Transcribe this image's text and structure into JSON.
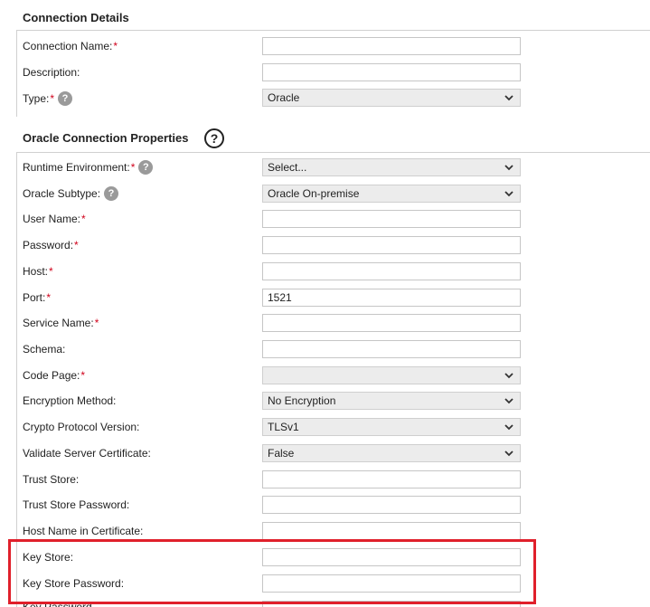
{
  "connection_details": {
    "title": "Connection Details",
    "fields": [
      {
        "label": "Connection Name:",
        "required": true,
        "value": ""
      },
      {
        "label": "Description:",
        "required": false,
        "value": ""
      },
      {
        "label": "Type:",
        "required": true,
        "value": "Oracle"
      }
    ]
  },
  "oracle_properties": {
    "title": "Oracle Connection Properties",
    "help_icon": "?",
    "fields": [
      {
        "label": "Runtime Environment:",
        "required": true,
        "value": "Select..."
      },
      {
        "label": "Oracle Subtype:",
        "required": false,
        "value": "Oracle On-premise"
      },
      {
        "label": "User Name:",
        "required": true,
        "value": ""
      },
      {
        "label": "Password:",
        "required": true,
        "value": ""
      },
      {
        "label": "Host:",
        "required": true,
        "value": ""
      },
      {
        "label": "Port:",
        "required": true,
        "value": "1521"
      },
      {
        "label": "Service Name:",
        "required": true,
        "value": ""
      },
      {
        "label": "Schema:",
        "required": false,
        "value": ""
      },
      {
        "label": "Code Page:",
        "required": true,
        "value": ""
      },
      {
        "label": "Encryption Method:",
        "required": false,
        "value": "No Encryption"
      },
      {
        "label": "Crypto Protocol Version:",
        "required": false,
        "value": "TLSv1"
      },
      {
        "label": "Validate Server Certificate:",
        "required": false,
        "value": "False"
      },
      {
        "label": "Trust Store:",
        "required": false,
        "value": ""
      },
      {
        "label": "Trust Store Password:",
        "required": false,
        "value": ""
      },
      {
        "label": "Host Name in Certificate:",
        "required": false,
        "value": ""
      },
      {
        "label": "Key Store:",
        "required": false,
        "value": ""
      },
      {
        "label": "Key Store Password:",
        "required": false,
        "value": ""
      },
      {
        "label": "Key Password",
        "required": false,
        "value": ""
      }
    ]
  },
  "icons": {
    "help": "question-icon",
    "dropdown": "chevron-down-icon"
  },
  "colors": {
    "required": "#d0021b",
    "highlight": "#e0202b"
  },
  "required_mark": "*"
}
